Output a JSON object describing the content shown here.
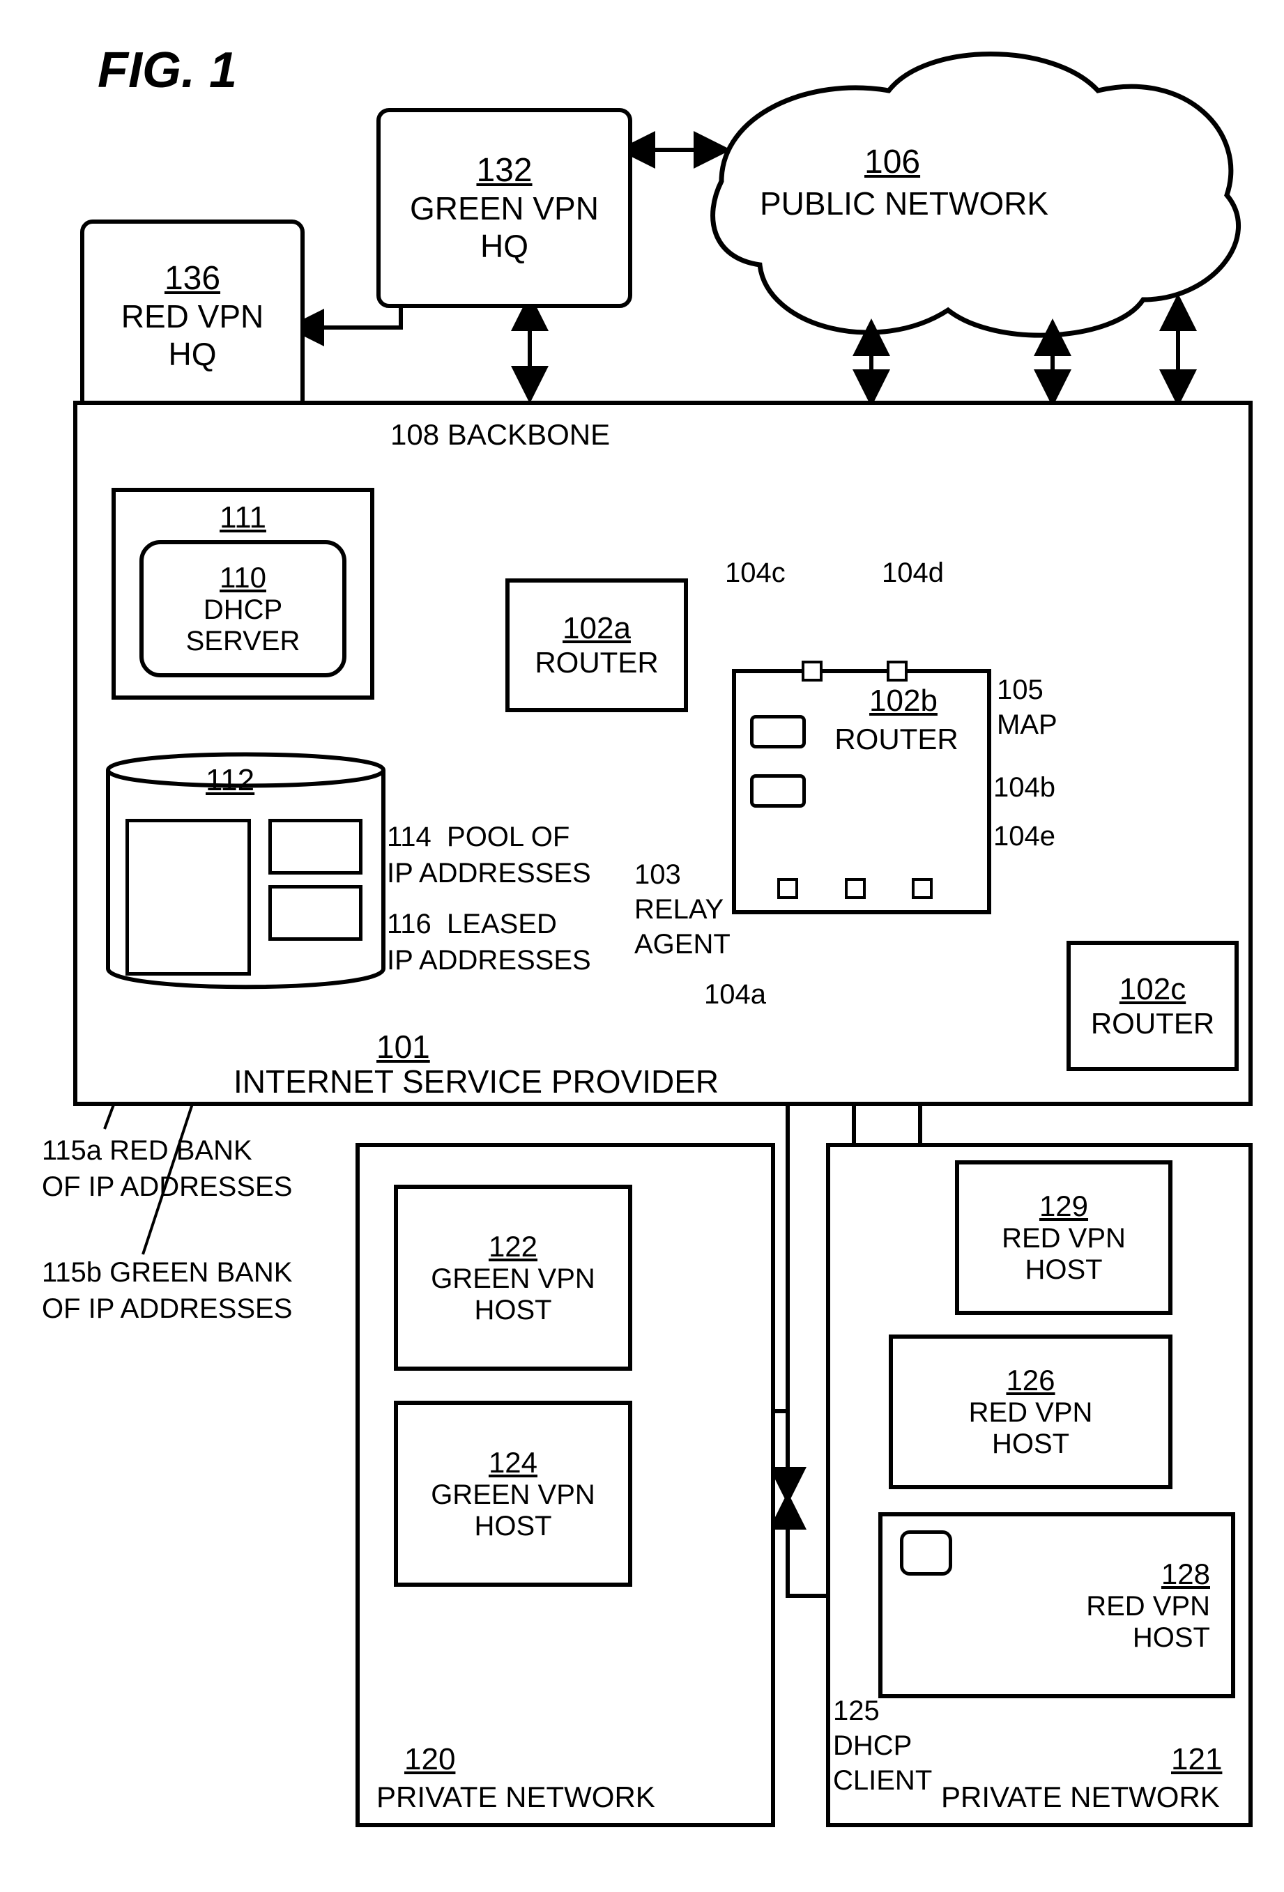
{
  "figureTitle": "FIG. 1",
  "nodes": {
    "greenHQ": {
      "ref": "132",
      "l1": "GREEN VPN",
      "l2": "HQ"
    },
    "redHQ": {
      "ref": "136",
      "l1": "RED VPN",
      "l2": "HQ"
    },
    "cloud": {
      "ref": "106",
      "l1": "PUBLIC NETWORK"
    },
    "isp": {
      "ref": "101",
      "l1": "INTERNET SERVICE PROVIDER"
    },
    "dhcpBox": {
      "ref": "111"
    },
    "dhcp": {
      "ref": "110",
      "l1": "DHCP",
      "l2": "SERVER"
    },
    "db": {
      "ref": "112"
    },
    "routerA": {
      "ref": "102a",
      "l1": "ROUTER"
    },
    "routerB": {
      "ref": "102b",
      "l1": "ROUTER"
    },
    "routerC": {
      "ref": "102c",
      "l1": "ROUTER"
    },
    "priv120": {
      "ref": "120",
      "l1": "PRIVATE NETWORK"
    },
    "priv121": {
      "ref": "121",
      "l1": "PRIVATE NETWORK"
    },
    "host122": {
      "ref": "122",
      "l1": "GREEN VPN",
      "l2": "HOST"
    },
    "host124": {
      "ref": "124",
      "l1": "GREEN VPN",
      "l2": "HOST"
    },
    "host126": {
      "ref": "126",
      "l1": "RED VPN",
      "l2": "HOST"
    },
    "host128": {
      "ref": "128",
      "l1": "RED VPN",
      "l2": "HOST"
    },
    "host129": {
      "ref": "129",
      "l1": "RED VPN",
      "l2": "HOST"
    }
  },
  "labels": {
    "backbone": "108 BACKBONE",
    "pool": {
      "ref": "114",
      "t": "POOL OF",
      "t2": "IP ADDRESSES"
    },
    "leased": {
      "ref": "116",
      "t": "LEASED",
      "t2": "IP ADDRESSES"
    },
    "relay": {
      "ref": "103",
      "t": "RELAY",
      "t2": "AGENT"
    },
    "map": {
      "ref": "105",
      "t": "MAP"
    },
    "p104a": "104a",
    "p104b": "104b",
    "p104c": "104c",
    "p104d": "104d",
    "p104e": "104e",
    "redBank": {
      "ref": "115a",
      "t": "RED BANK",
      "t2": "OF IP ADDRESSES"
    },
    "greenBank": {
      "ref": "115b",
      "t": "GREEN BANK",
      "t2": "OF IP ADDRESSES"
    },
    "dhcpClient": {
      "ref": "125",
      "t": "DHCP",
      "t2": "CLIENT"
    }
  }
}
